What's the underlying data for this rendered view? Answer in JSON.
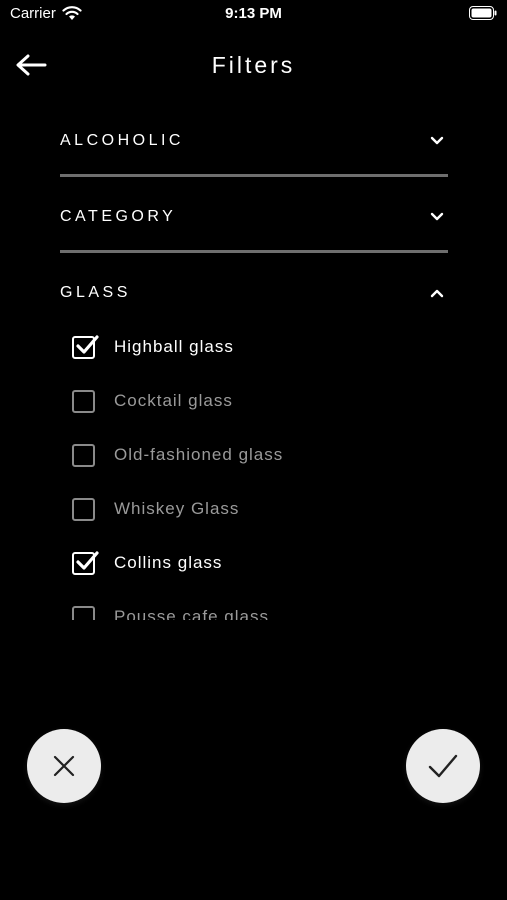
{
  "status_bar": {
    "carrier": "Carrier",
    "time": "9:13 PM"
  },
  "header": {
    "title": "Filters",
    "back_icon": "arrow-left-icon"
  },
  "sections": [
    {
      "label": "ALCOHOLIC",
      "expanded": false
    },
    {
      "label": "CATEGORY",
      "expanded": false
    },
    {
      "label": "GLASS",
      "expanded": true
    }
  ],
  "glass_options": [
    {
      "label": "Highball glass",
      "checked": true
    },
    {
      "label": "Cocktail glass",
      "checked": false
    },
    {
      "label": "Old-fashioned glass",
      "checked": false
    },
    {
      "label": "Whiskey Glass",
      "checked": false
    },
    {
      "label": "Collins glass",
      "checked": true
    },
    {
      "label": "Pousse cafe glass",
      "checked": false
    }
  ],
  "actions": {
    "cancel_icon": "close-icon",
    "confirm_icon": "checkmark-icon"
  },
  "colors": {
    "background": "#000000",
    "divider": "#6e6e6e",
    "fab": "#ececec",
    "inactive_text": "#9a9a9a"
  }
}
